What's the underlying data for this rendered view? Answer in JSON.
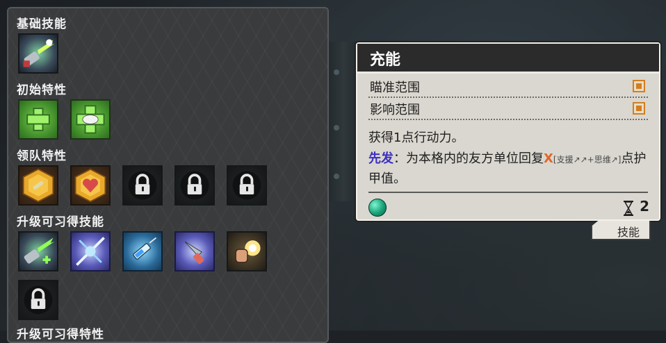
{
  "left_panel": {
    "sections": [
      {
        "title": "基础技能"
      },
      {
        "title": "初始特性"
      },
      {
        "title": "领队特性"
      },
      {
        "title": "升级可习得技能"
      },
      {
        "title": "升级可习得特性"
      }
    ],
    "icons": {
      "basic": [
        "tool-beam-icon"
      ],
      "initial": [
        "green-cross-icon",
        "green-cross-handshake-icon"
      ],
      "leader": [
        "gold-bone-badge-icon",
        "gold-heart-badge-icon",
        "lock-icon",
        "lock-icon",
        "lock-icon"
      ],
      "upgrade": [
        "tool-beam-plus-icon",
        "blue-slash-icon",
        "syringe-icon",
        "drill-icon",
        "punch-glow-icon",
        "lock-icon"
      ]
    }
  },
  "skill_card": {
    "title": "充能",
    "props": [
      {
        "label": "瞄准范围"
      },
      {
        "label": "影响范围"
      }
    ],
    "desc_line1": "获得1点行动力。",
    "keyword": "先发",
    "desc_part1": "：为本格内的友方单位回复",
    "x_value": "X",
    "note": "[支援↗↗+思维↗]",
    "desc_part2": "点护甲值。",
    "cost": "2",
    "tag": "技能",
    "colors": {
      "keyword": "#3b2fbf",
      "x_value": "#e2662a",
      "checkbox": "#d27e22"
    }
  }
}
